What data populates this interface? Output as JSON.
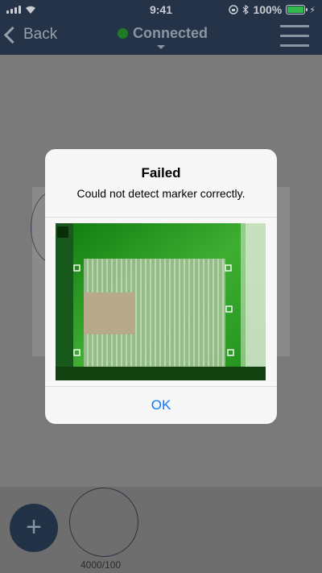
{
  "status_bar": {
    "time": "9:41",
    "battery": "100%"
  },
  "nav": {
    "back_label": "Back",
    "connection_status": "Connected"
  },
  "workspace": {
    "job_size_label": "4000/100"
  },
  "alert": {
    "title": "Failed",
    "message": "Could not detect marker correctly.",
    "ok_label": "OK",
    "image_markers": 6
  },
  "colors": {
    "nav_bg": "#243347",
    "connected_dot": "#1f7a28",
    "link_blue": "#0a7aff",
    "add_button": "#223246"
  }
}
